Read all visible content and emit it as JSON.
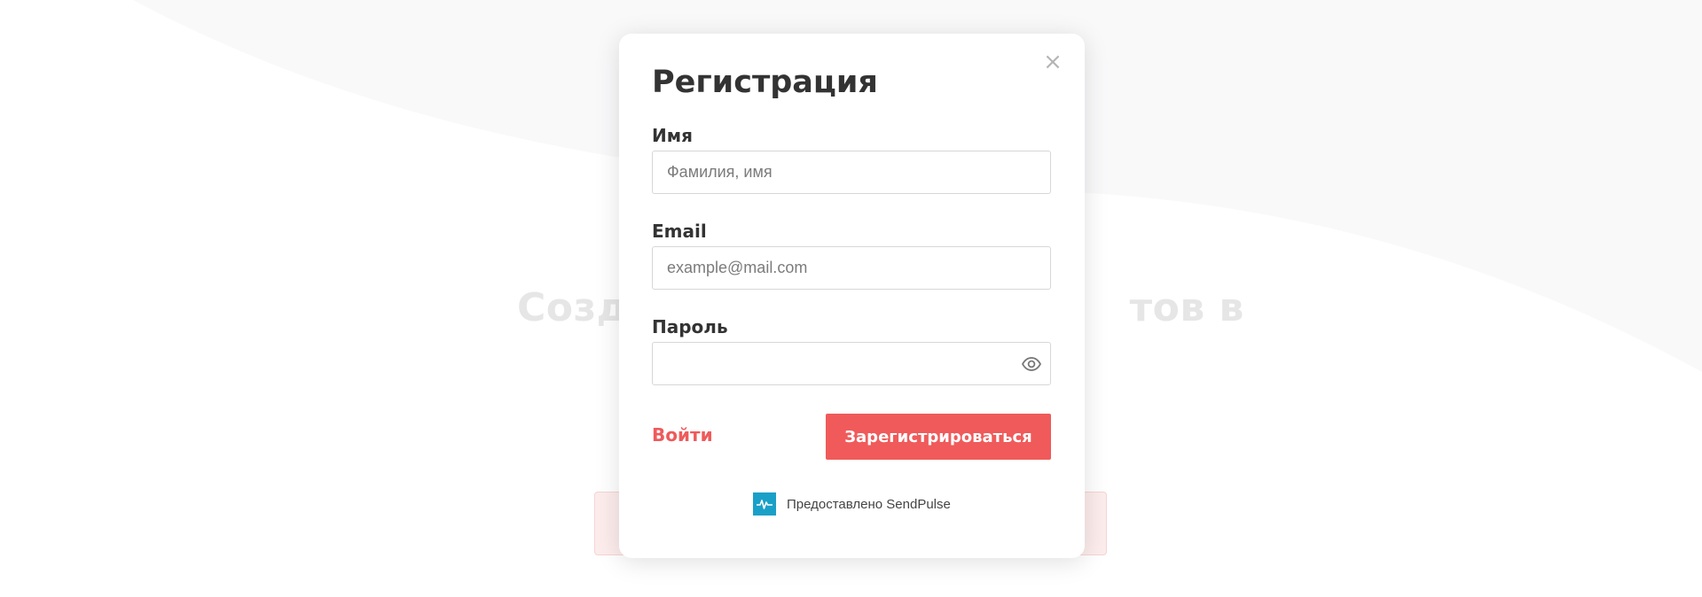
{
  "background": {
    "heading_left": "Созд",
    "heading_right": "тов в"
  },
  "modal": {
    "title": "Регистрация",
    "close_symbol": "×",
    "fields": {
      "name": {
        "label": "Имя",
        "placeholder": "Фамилия, имя",
        "value": ""
      },
      "email": {
        "label": "Email",
        "placeholder": "example@mail.com",
        "value": ""
      },
      "password": {
        "label": "Пароль",
        "placeholder": "",
        "value": "",
        "toggle_icon": "eye-icon"
      }
    },
    "login_link": "Войти",
    "register_button": "Зарегистрироваться",
    "powered_by": "Предоставлено SendPulse",
    "powered_logo_icon": "sendpulse-pulse-icon"
  },
  "colors": {
    "accent": "#f05a5a",
    "text": "#333333",
    "logo_bg": "#1aa0c8"
  }
}
